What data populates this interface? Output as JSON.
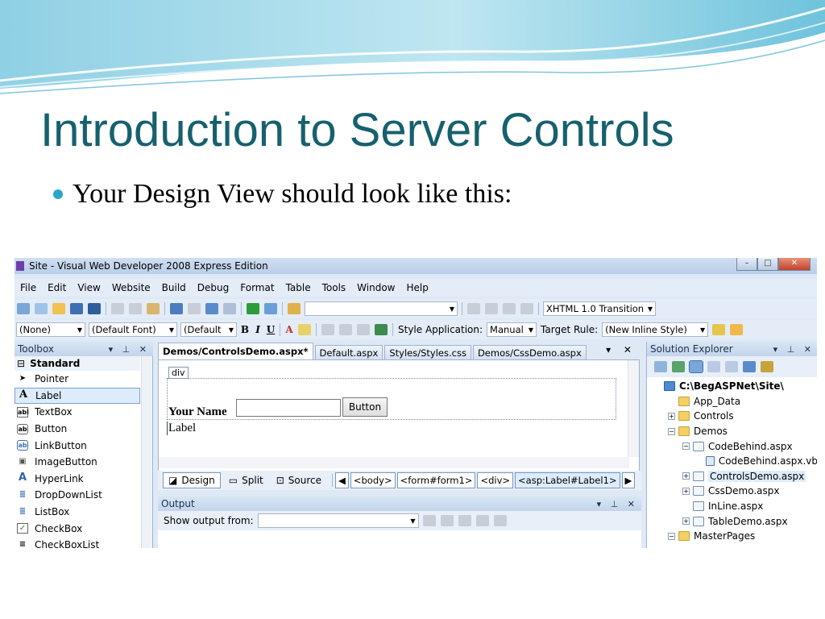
{
  "slide": {
    "title": "Introduction to Server Controls",
    "bullet": "Your Design View should look like this:"
  },
  "ide": {
    "window_title": "Site - Visual Web Developer 2008 Express Edition",
    "menu": [
      "File",
      "Edit",
      "View",
      "Website",
      "Build",
      "Debug",
      "Format",
      "Table",
      "Tools",
      "Window",
      "Help"
    ],
    "toolbar1": {
      "doctype": "XHTML 1.0 Transition"
    },
    "toolbar2": {
      "block_format": "(None)",
      "font": "(Default Font)",
      "font_size": "(Default",
      "style_app_label": "Style Application:",
      "style_app_value": "Manual",
      "target_rule_label": "Target Rule:",
      "target_rule_value": "(New Inline Style)"
    },
    "toolbox": {
      "title": "Toolbox",
      "group": "Standard",
      "items": [
        {
          "label": "Pointer",
          "icon": "pointer-icon",
          "glyph": "➤"
        },
        {
          "label": "Label",
          "icon": "label-icon",
          "glyph": "A"
        },
        {
          "label": "TextBox",
          "icon": "textbox-icon",
          "glyph": "abl"
        },
        {
          "label": "Button",
          "icon": "button-icon",
          "glyph": "ab"
        },
        {
          "label": "LinkButton",
          "icon": "linkbutton-icon",
          "glyph": "ab"
        },
        {
          "label": "ImageButton",
          "icon": "imagebutton-icon",
          "glyph": "▣"
        },
        {
          "label": "HyperLink",
          "icon": "hyperlink-icon",
          "glyph": "A"
        },
        {
          "label": "DropDownList",
          "icon": "dropdownlist-icon",
          "glyph": "≣"
        },
        {
          "label": "ListBox",
          "icon": "listbox-icon",
          "glyph": "≣"
        },
        {
          "label": "CheckBox",
          "icon": "checkbox-icon",
          "glyph": "✓"
        },
        {
          "label": "CheckBoxList",
          "icon": "checkboxlist-icon",
          "glyph": "≡"
        }
      ]
    },
    "editor": {
      "tabs": [
        "Demos/ControlsDemo.aspx*",
        "Default.aspx",
        "Styles/Styles.css",
        "Demos/CssDemo.aspx"
      ],
      "div_tag": "div",
      "your_name": "Your Name",
      "button_text": "Button",
      "label_text": "Label",
      "views": [
        "Design",
        "Split",
        "Source"
      ],
      "breadcrumbs": [
        "<body>",
        "<form#form1>",
        "<div>",
        "<asp:Label#Label1>"
      ]
    },
    "output": {
      "title": "Output",
      "show_from_label": "Show output from:"
    },
    "solution": {
      "title": "Solution Explorer",
      "nodes": [
        {
          "label": "C:\\BegASPNet\\Site\\",
          "type": "proj",
          "indent": 0,
          "exp": ""
        },
        {
          "label": "App_Data",
          "type": "folder",
          "indent": 1,
          "exp": ""
        },
        {
          "label": "Controls",
          "type": "folder",
          "indent": 1,
          "exp": "+"
        },
        {
          "label": "Demos",
          "type": "folder",
          "indent": 1,
          "exp": "−"
        },
        {
          "label": "CodeBehind.aspx",
          "type": "page",
          "indent": 2,
          "exp": "−"
        },
        {
          "label": "CodeBehind.aspx.vb",
          "type": "vbfile",
          "indent": 3,
          "exp": ""
        },
        {
          "label": "ControlsDemo.aspx",
          "type": "page",
          "indent": 2,
          "exp": "+"
        },
        {
          "label": "CssDemo.aspx",
          "type": "page",
          "indent": 2,
          "exp": "+"
        },
        {
          "label": "InLine.aspx",
          "type": "page",
          "indent": 2,
          "exp": ""
        },
        {
          "label": "TableDemo.aspx",
          "type": "page",
          "indent": 2,
          "exp": "+"
        },
        {
          "label": "MasterPages",
          "type": "folder",
          "indent": 1,
          "exp": "−"
        }
      ]
    }
  },
  "colors": {
    "title": "#17606e",
    "bullet": "#2aa7c8",
    "ide_chrome": "#dfe9f5"
  }
}
